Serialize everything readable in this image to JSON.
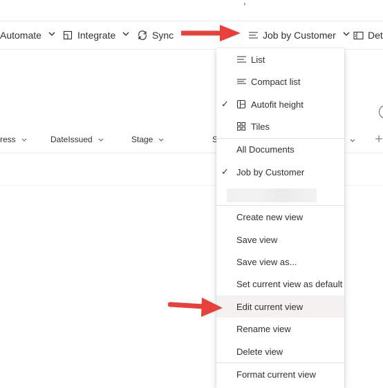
{
  "top_fragments": [
    ",",
    "ʼ"
  ],
  "command_bar": {
    "automate": "Automate",
    "integrate": "Integrate",
    "sync": "Sync",
    "view_switch": "Job by Customer",
    "details_partial": "Deta"
  },
  "columns": {
    "address_partial": "ress",
    "date_issued": "DateIssued",
    "stage": "Stage",
    "s_partial": "S"
  },
  "view_menu": {
    "layouts": [
      {
        "label": "List",
        "icon": "list-icon",
        "checked": false
      },
      {
        "label": "Compact list",
        "icon": "compact-list-icon",
        "checked": false
      },
      {
        "label": "Autofit height",
        "icon": "autofit-icon",
        "checked": true
      },
      {
        "label": "Tiles",
        "icon": "tiles-icon",
        "checked": false
      }
    ],
    "views": [
      {
        "label": "All Documents",
        "checked": false
      },
      {
        "label": "Job by Customer",
        "checked": true
      }
    ],
    "actions": [
      {
        "label": "Create new view"
      },
      {
        "label": "Save view"
      },
      {
        "label": "Save view as..."
      },
      {
        "label": "Set current view as default"
      },
      {
        "label": "Edit current view",
        "highlighted": true
      },
      {
        "label": "Rename view"
      },
      {
        "label": "Delete view"
      }
    ],
    "format": "Format current view",
    "check_glyph": "✓"
  },
  "annotation_arrows": {
    "color": "#e8403a"
  }
}
